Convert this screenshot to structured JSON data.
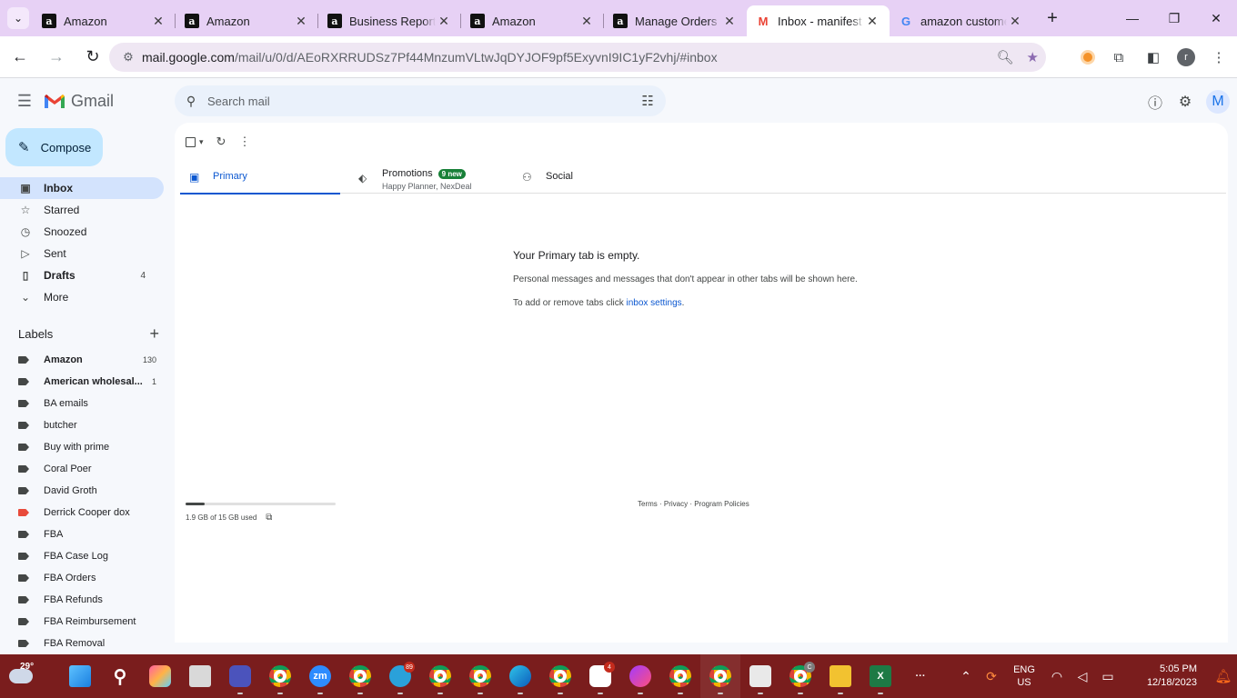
{
  "browser": {
    "tabs": [
      {
        "favicon": "amazon-icon",
        "title": "Amazon",
        "active": false
      },
      {
        "favicon": "amazon-icon",
        "title": "Amazon",
        "active": false
      },
      {
        "favicon": "amazon-icon",
        "title": "Business Report",
        "active": false
      },
      {
        "favicon": "amazon-icon",
        "title": "Amazon",
        "active": false
      },
      {
        "favicon": "amazon-icon",
        "title": "Manage Orders",
        "active": false
      },
      {
        "favicon": "gmail-icon",
        "title": "Inbox - manifest",
        "active": true
      },
      {
        "favicon": "google-icon",
        "title": "amazon customer",
        "active": false
      }
    ],
    "url_host": "mail.google.com",
    "url_path": "/mail/u/0/d/AEoRXRRUDSz7Pf44MnzumVLtwJqDYJOF9pf5ExyvnI9IC1yF2vhj/#inbox",
    "profile_initial": "r"
  },
  "gmail": {
    "app_name": "Gmail",
    "search_placeholder": "Search mail",
    "avatar_initial": "M",
    "compose_label": "Compose",
    "nav": [
      {
        "icon": "inbox-icon",
        "label": "Inbox",
        "count": "",
        "active": true,
        "bold": true
      },
      {
        "icon": "star-icon",
        "label": "Starred",
        "count": "",
        "active": false,
        "bold": false
      },
      {
        "icon": "clock-icon",
        "label": "Snoozed",
        "count": "",
        "active": false,
        "bold": false
      },
      {
        "icon": "send-icon",
        "label": "Sent",
        "count": "",
        "active": false,
        "bold": false
      },
      {
        "icon": "draft-icon",
        "label": "Drafts",
        "count": "4",
        "active": false,
        "bold": true
      },
      {
        "icon": "chevron-down-icon",
        "label": "More",
        "count": "",
        "active": false,
        "bold": false
      }
    ],
    "labels_title": "Labels",
    "labels": [
      {
        "name": "Amazon",
        "count": "130",
        "bold": true,
        "color": "#444746"
      },
      {
        "name": "American wholesal...",
        "count": "1",
        "bold": true,
        "color": "#444746"
      },
      {
        "name": "BA emails",
        "count": "",
        "bold": false,
        "color": "#444746"
      },
      {
        "name": "butcher",
        "count": "",
        "bold": false,
        "color": "#444746"
      },
      {
        "name": "Buy with prime",
        "count": "",
        "bold": false,
        "color": "#444746"
      },
      {
        "name": "Coral Poer",
        "count": "",
        "bold": false,
        "color": "#444746"
      },
      {
        "name": "David Groth",
        "count": "",
        "bold": false,
        "color": "#444746"
      },
      {
        "name": "Derrick Cooper dox",
        "count": "",
        "bold": false,
        "color": "#e84a3b"
      },
      {
        "name": "FBA",
        "count": "",
        "bold": false,
        "color": "#444746"
      },
      {
        "name": "FBA Case Log",
        "count": "",
        "bold": false,
        "color": "#444746"
      },
      {
        "name": "FBA Orders",
        "count": "",
        "bold": false,
        "color": "#444746"
      },
      {
        "name": "FBA Refunds",
        "count": "",
        "bold": false,
        "color": "#444746"
      },
      {
        "name": "FBA Reimbursement",
        "count": "",
        "bold": false,
        "color": "#444746"
      },
      {
        "name": "FBA Removal",
        "count": "",
        "bold": false,
        "color": "#444746"
      }
    ],
    "inbox_tabs": [
      {
        "icon": "inbox-icon",
        "label": "Primary",
        "badge": "",
        "sub": "",
        "active": true
      },
      {
        "icon": "tag-icon",
        "label": "Promotions",
        "badge": "9 new",
        "sub": "Happy Planner, NexDeal",
        "active": false
      },
      {
        "icon": "people-icon",
        "label": "Social",
        "badge": "",
        "sub": "",
        "active": false
      }
    ],
    "empty_title": "Your Primary tab is empty.",
    "empty_desc": "Personal messages and messages that don't appear in other tabs will be shown here.",
    "empty_settings_prefix": "To add or remove tabs click ",
    "empty_settings_link": "inbox settings",
    "empty_settings_suffix": ".",
    "storage_text": "1.9 GB of 15 GB used",
    "storage_fraction": 0.127,
    "footer": "Terms · Privacy · Program Policies"
  },
  "taskbar": {
    "temperature": "29°",
    "apps": [
      {
        "name": "start-button",
        "badge": ""
      },
      {
        "name": "search-button",
        "badge": ""
      },
      {
        "name": "app-pre",
        "badge": ""
      },
      {
        "name": "app-window",
        "badge": ""
      },
      {
        "name": "app-meet",
        "badge": ""
      },
      {
        "name": "chrome-a",
        "badge": ""
      },
      {
        "name": "zoom",
        "badge": ""
      },
      {
        "name": "chrome-b",
        "badge": ""
      },
      {
        "name": "telegram",
        "badge": "89"
      },
      {
        "name": "chrome-c",
        "badge": ""
      },
      {
        "name": "chrome-d",
        "badge": ""
      },
      {
        "name": "edge",
        "badge": ""
      },
      {
        "name": "chrome-e",
        "badge": ""
      },
      {
        "name": "slack",
        "badge": "4"
      },
      {
        "name": "messenger",
        "badge": ""
      },
      {
        "name": "chrome-f",
        "badge": ""
      },
      {
        "name": "chrome-g",
        "badge": ""
      },
      {
        "name": "snipping-tool",
        "badge": ""
      },
      {
        "name": "chrome-h",
        "badge": "C"
      },
      {
        "name": "file-explorer",
        "badge": ""
      },
      {
        "name": "excel",
        "badge": ""
      },
      {
        "name": "more-apps",
        "badge": ""
      }
    ],
    "lang_line1": "ENG",
    "lang_line2": "US",
    "time": "5:05 PM",
    "date": "12/18/2023"
  },
  "colors": {
    "compose_bg": "#c2e7ff",
    "active_nav_bg": "#d3e3fd",
    "primary_blue": "#0b57d0",
    "promo_badge": "#188038",
    "taskbar_bg": "#7a1d1d",
    "tabstrip_bg": "#e7d1f5"
  }
}
